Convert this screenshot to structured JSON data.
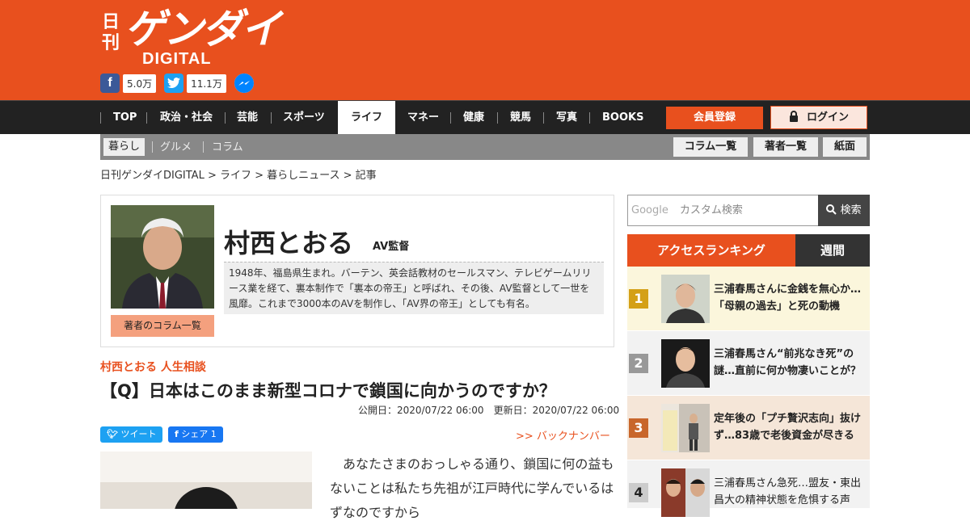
{
  "brand": {
    "small": "日刊",
    "main": "ゲンダイ",
    "sub": "DIGITAL"
  },
  "social": {
    "facebook_count": "5.0万",
    "twitter_count": "11.1万"
  },
  "nav": {
    "items": [
      "TOP",
      "政治・社会",
      "芸能",
      "スポーツ",
      "ライフ",
      "マネー",
      "健康",
      "競馬",
      "写真",
      "BOOKS"
    ],
    "active": "ライフ",
    "register": "会員登録",
    "login": "ログイン"
  },
  "subnav": {
    "items": [
      "暮らし",
      "グルメ",
      "コラム"
    ],
    "active": "暮らし",
    "buttons": [
      "コラム一覧",
      "著者一覧",
      "紙面"
    ]
  },
  "breadcrumb": "日刊ゲンダイDIGITAL > ライフ > 暮らしニュース > 記事",
  "author": {
    "name": "村西とおる",
    "role": "AV監督",
    "bio": "1948年、福島県生まれ。バーテン、英会話教材のセールスマン、テレビゲームリリース業を経て、裏本制作で「裏本の帝王」と呼ばれ、その後、AV監督として一世を風靡。これまで3000本のAVを制作し、「AV界の帝王」としても有名。",
    "column_button": "著者のコラム一覧"
  },
  "article": {
    "category": "村西とおる 人生相談",
    "title": "【Q】日本はこのまま新型コロナで鎖国に向かうのですか？",
    "published": "公開日：2020/07/22 06:00",
    "updated": "更新日：2020/07/22 06:00",
    "tweet": "ツイート",
    "share": "シェア 1",
    "backnumber": ">> バックナンバー",
    "body": "　あなたさまのおっしゃる通り、鎖国に何の益もないことは私たち先祖が江戸時代に学んでいるはずなのですから"
  },
  "search": {
    "brand": "Google",
    "placeholder": "カスタム検索",
    "button": "検索"
  },
  "ranking": {
    "title": "アクセスランキング",
    "period": "週間",
    "items": [
      {
        "rank": "1",
        "text": "三浦春馬さんに金銭を無心か…「母親の過去」と死の動機"
      },
      {
        "rank": "2",
        "text": "三浦春馬さん“前兆なき死”の謎…直前に何か物凄いことが？"
      },
      {
        "rank": "3",
        "text": "定年後の「プチ贅沢志向」抜けず…83歳で老後資金が尽きる"
      },
      {
        "rank": "4",
        "text": "三浦春馬さん急死…盟友・東出昌大の精神状態を危惧する声"
      }
    ]
  },
  "colors": {
    "brand": "#e8501e",
    "rank1": "#d4a017",
    "rank2": "#999999",
    "rank3": "#c8662b",
    "rank4": "#cccccc"
  }
}
